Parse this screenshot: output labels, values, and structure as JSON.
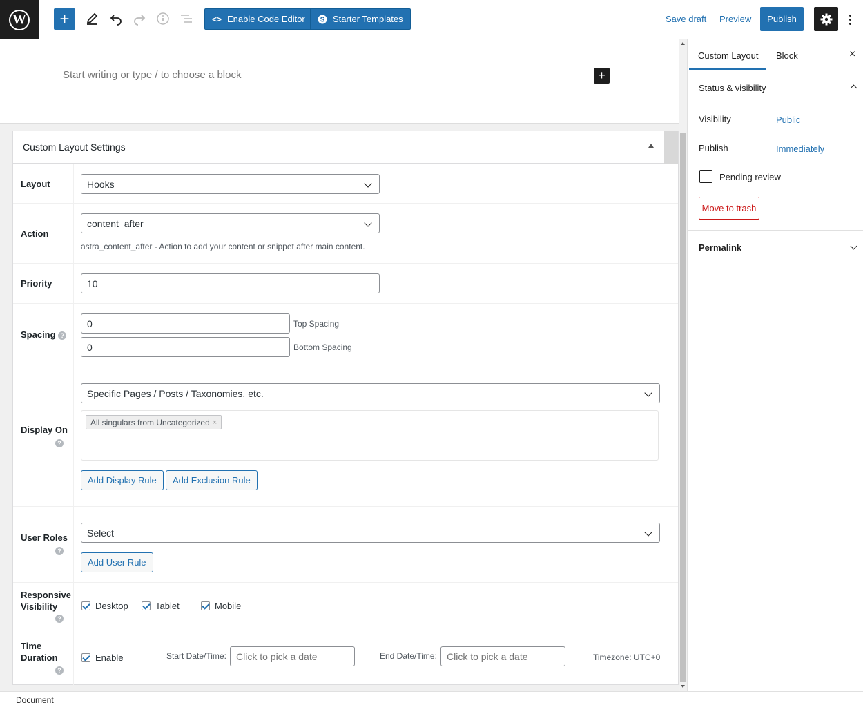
{
  "toolbar": {
    "enable_code_editor": "Enable Code Editor",
    "starter_templates": "Starter Templates",
    "save_draft": "Save draft",
    "preview": "Preview",
    "publish": "Publish"
  },
  "editor": {
    "placeholder": "Start writing or type / to choose a block"
  },
  "meta_box": {
    "title": "Custom Layout Settings",
    "layout": {
      "label": "Layout",
      "value": "Hooks"
    },
    "action": {
      "label": "Action",
      "value": "content_after",
      "description": "astra_content_after - Action to add your content or snippet after main content."
    },
    "priority": {
      "label": "Priority",
      "value": "10"
    },
    "spacing": {
      "label": "Spacing",
      "top_value": "0",
      "top_label": "Top Spacing",
      "bottom_value": "0",
      "bottom_label": "Bottom Spacing"
    },
    "display_on": {
      "label": "Display On",
      "value": "Specific Pages / Posts / Taxonomies, etc.",
      "chip": "All singulars from Uncategorized",
      "chip_remove": "×",
      "add_display_rule": "Add Display Rule",
      "add_exclusion_rule": "Add Exclusion Rule"
    },
    "user_roles": {
      "label": "User Roles",
      "value": "Select",
      "add_user_rule": "Add User Rule"
    },
    "responsive": {
      "label_line1": "Responsive",
      "label_line2": "Visibility",
      "options": [
        {
          "label": "Desktop",
          "checked": true
        },
        {
          "label": "Tablet",
          "checked": true
        },
        {
          "label": "Mobile",
          "checked": true
        }
      ]
    },
    "time_duration": {
      "label_line1": "Time",
      "label_line2": "Duration",
      "enable_label": "Enable",
      "enable_checked": true,
      "start_label": "Start Date/Time:",
      "start_placeholder": "Click to pick a date",
      "end_label": "End Date/Time:",
      "end_placeholder": "Click to pick a date",
      "timezone": "Timezone: UTC+0"
    },
    "help_glyph": "?"
  },
  "sidebar": {
    "tab_custom_layout": "Custom Layout",
    "tab_block": "Block",
    "close": "×",
    "status_visibility": "Status & visibility",
    "visibility_label": "Visibility",
    "visibility_value": "Public",
    "publish_label": "Publish",
    "publish_value": "Immediately",
    "pending_review": "Pending review",
    "move_to_trash": "Move to trash",
    "permalink": "Permalink"
  },
  "footer": {
    "breadcrumb": "Document"
  },
  "colors": {
    "accent": "#2271b1",
    "danger": "#cc1818",
    "dark": "#1e1e1e"
  }
}
